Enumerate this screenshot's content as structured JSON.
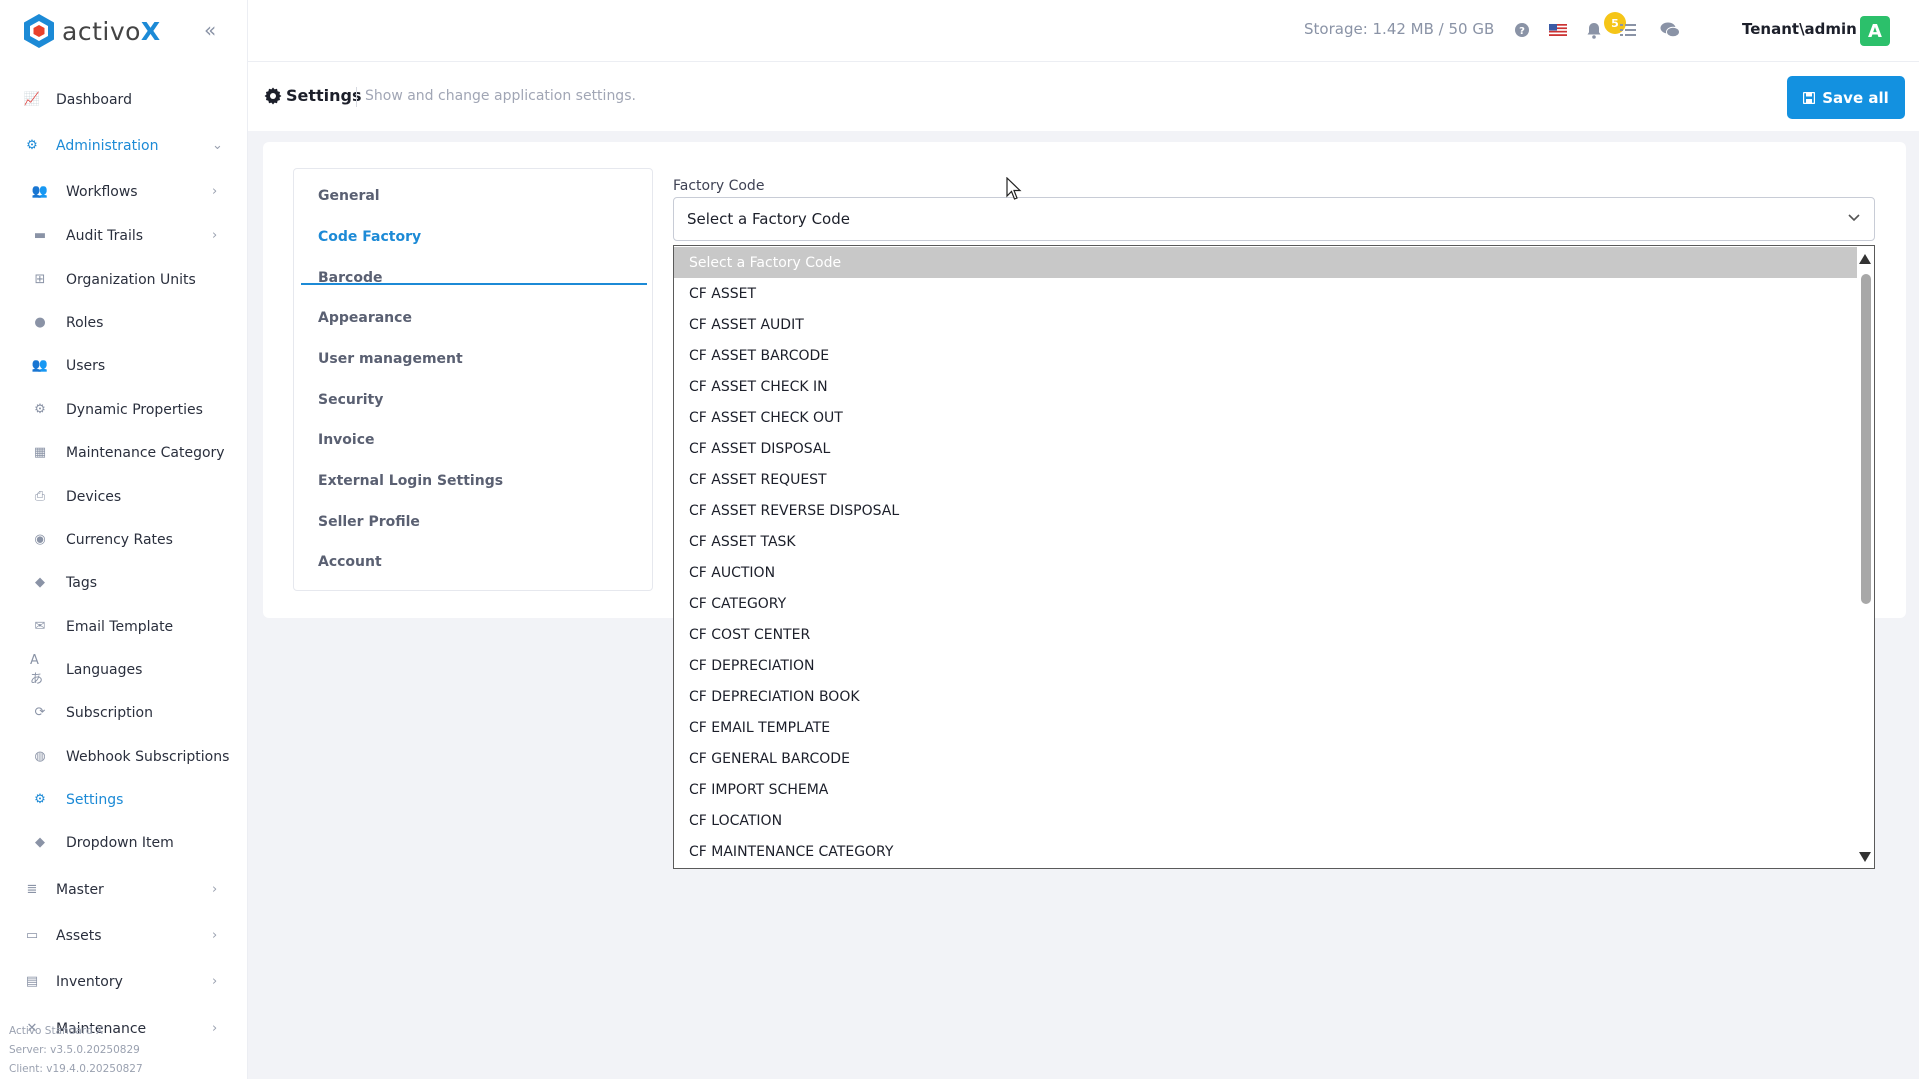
{
  "brand": {
    "name_prefix": "activo",
    "name_suffix": "X"
  },
  "sidebar": {
    "items": [
      {
        "label": "Dashboard",
        "icon": "chart-line-icon"
      },
      {
        "label": "Administration",
        "icon": "cogs-icon"
      },
      {
        "label": "Workflows",
        "icon": "users-icon"
      },
      {
        "label": "Audit Trails",
        "icon": "folder-icon"
      },
      {
        "label": "Organization Units",
        "icon": "sitemap-icon"
      },
      {
        "label": "Roles",
        "icon": "user-tie-icon"
      },
      {
        "label": "Users",
        "icon": "users-icon"
      },
      {
        "label": "Dynamic Properties",
        "icon": "gear-icon"
      },
      {
        "label": "Maintenance Category",
        "icon": "grid-icon"
      },
      {
        "label": "Devices",
        "icon": "print-icon"
      },
      {
        "label": "Currency Rates",
        "icon": "coins-icon"
      },
      {
        "label": "Tags",
        "icon": "tags-icon"
      },
      {
        "label": "Email Template",
        "icon": "envelope-icon"
      },
      {
        "label": "Languages",
        "icon": "language-icon"
      },
      {
        "label": "Subscription",
        "icon": "sync-icon"
      },
      {
        "label": "Webhook Subscriptions",
        "icon": "globe-icon"
      },
      {
        "label": "Settings",
        "icon": "gear-icon"
      },
      {
        "label": "Dropdown Item",
        "icon": "tags-icon"
      },
      {
        "label": "Master",
        "icon": "database-icon"
      },
      {
        "label": "Assets",
        "icon": "laptop-icon"
      },
      {
        "label": "Inventory",
        "icon": "warehouse-icon"
      },
      {
        "label": "Maintenance",
        "icon": "tools-icon"
      }
    ],
    "footer": {
      "edition": "Activo Standard X",
      "server": "Server: v3.5.0.20250829",
      "client": "Client: v19.4.0.20250827"
    }
  },
  "topbar": {
    "storage": "Storage: 1.42 MB / 50 GB",
    "notification_count": "5",
    "tenant": "Tenant\\admin",
    "avatar_letter": "A"
  },
  "subheader": {
    "title": "Settings",
    "description": "Show and change application settings.",
    "save_label": "Save all"
  },
  "settings_tabs": [
    "General",
    "Code Factory",
    "Barcode",
    "Appearance",
    "User management",
    "Security",
    "Invoice",
    "External Login Settings",
    "Seller Profile",
    "Account"
  ],
  "factory_code": {
    "label": "Factory Code",
    "selected": "Select a Factory Code",
    "options": [
      "Select a Factory Code",
      "CF ASSET",
      "CF ASSET AUDIT",
      "CF ASSET BARCODE",
      "CF ASSET CHECK IN",
      "CF ASSET CHECK OUT",
      "CF ASSET DISPOSAL",
      "CF ASSET REQUEST",
      "CF ASSET REVERSE DISPOSAL",
      "CF ASSET TASK",
      "CF AUCTION",
      "CF CATEGORY",
      "CF COST CENTER",
      "CF DEPRECIATION",
      "CF DEPRECIATION BOOK",
      "CF EMAIL TEMPLATE",
      "CF GENERAL BARCODE",
      "CF IMPORT SCHEMA",
      "CF LOCATION",
      "CF MAINTENANCE CATEGORY"
    ]
  },
  "colors": {
    "accent": "#1c8ad6",
    "save_button": "#1391e0",
    "badge": "#f5c518",
    "avatar": "#2cc06b"
  }
}
